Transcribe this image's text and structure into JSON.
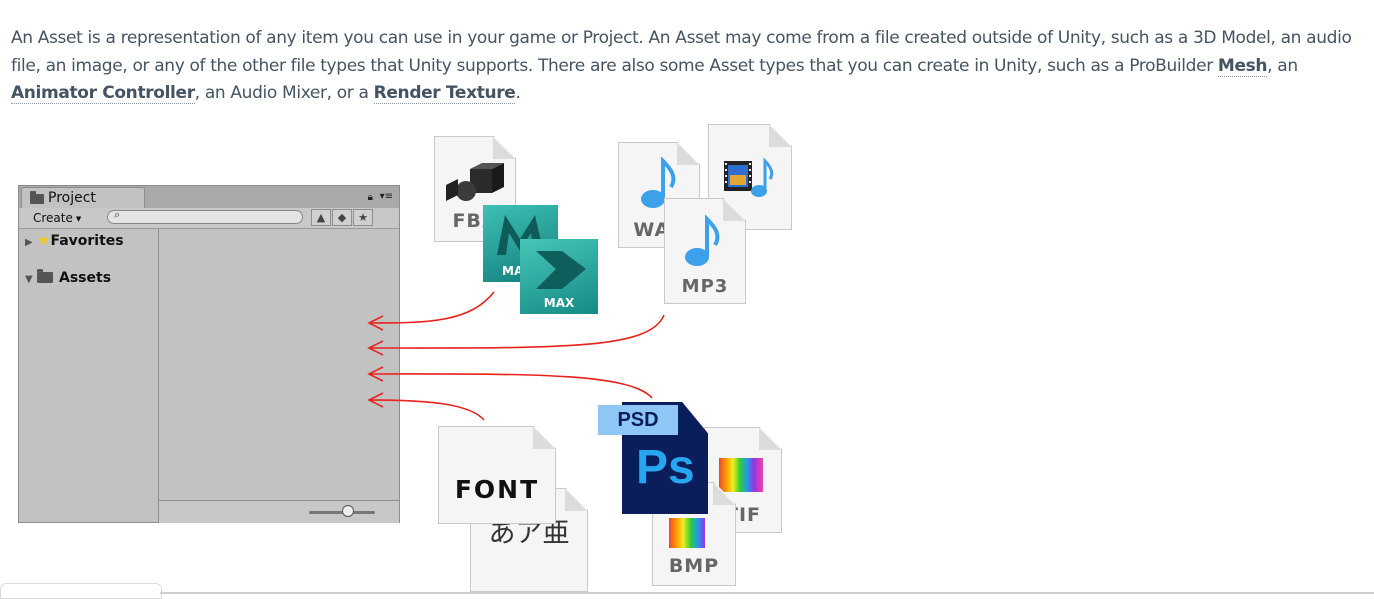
{
  "intro": {
    "text_1": "An Asset is a representation of any item you can use in your game or Project. An Asset may come from a file created outside of Unity, such as a 3D Model, an audio file, an image, or any of the other file types that Unity supports. There are also some Asset types that you can create in Unity, such as a ProBuilder ",
    "link_mesh": "Mesh",
    "text_2": ", an ",
    "link_animator": "Animator Controller",
    "text_3": ", an Audio Mixer, or a ",
    "link_render_texture": "Render Texture",
    "text_4": "."
  },
  "project_window": {
    "tab_title": "Project",
    "create_label": "Create",
    "favorites_label": "Favorites",
    "assets_label": "Assets"
  },
  "file_icons": {
    "fbx": "FBX",
    "maya": "MAYA",
    "max": "MAX",
    "wav": "WAV",
    "mp3": "MP3",
    "psd": "PSD",
    "ps": "Ps",
    "tif": "TIF",
    "bmp": "BMP",
    "font": "FONT",
    "japanese": "あア亜"
  },
  "colors": {
    "arrow": "#e8231c",
    "maya_teal": "#1f9e9a",
    "psd_blue": "#0b1e5c",
    "note_blue": "#3ca0ea"
  }
}
